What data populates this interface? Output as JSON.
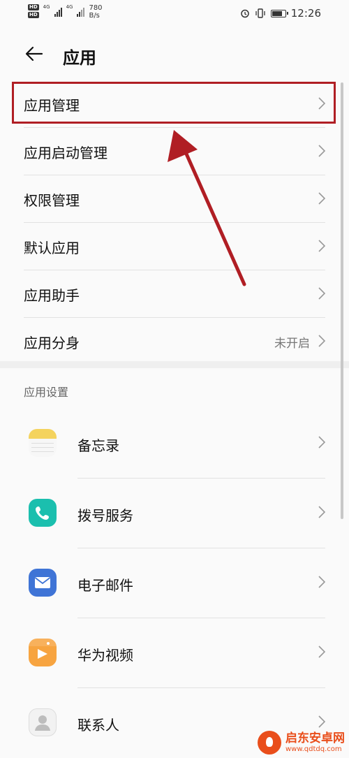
{
  "status_bar": {
    "hd1": "HD",
    "hd2": "HD",
    "net1": "4G",
    "net2": "4G",
    "speed_value": "780",
    "speed_unit": "B/s",
    "time": "12:26",
    "battery_level": 0.85
  },
  "header": {
    "title": "应用"
  },
  "menu": {
    "items": [
      {
        "label": "应用管理",
        "value": ""
      },
      {
        "label": "应用启动管理",
        "value": ""
      },
      {
        "label": "权限管理",
        "value": ""
      },
      {
        "label": "默认应用",
        "value": ""
      },
      {
        "label": "应用助手",
        "value": ""
      },
      {
        "label": "应用分身",
        "value": "未开启"
      }
    ]
  },
  "section": {
    "title": "应用设置"
  },
  "apps": [
    {
      "name": "备忘录",
      "color": "#f4d35e"
    },
    {
      "name": "拨号服务",
      "color": "#1bbfae"
    },
    {
      "name": "电子邮件",
      "color": "#3f74d6"
    },
    {
      "name": "华为视频",
      "color": "#f7a440"
    },
    {
      "name": "联系人",
      "color": "#cfcfcf"
    }
  ],
  "annotation": {
    "color": "#b01e24"
  },
  "watermark": {
    "name": "启东安卓网",
    "url": "www.qdtdq.com"
  }
}
